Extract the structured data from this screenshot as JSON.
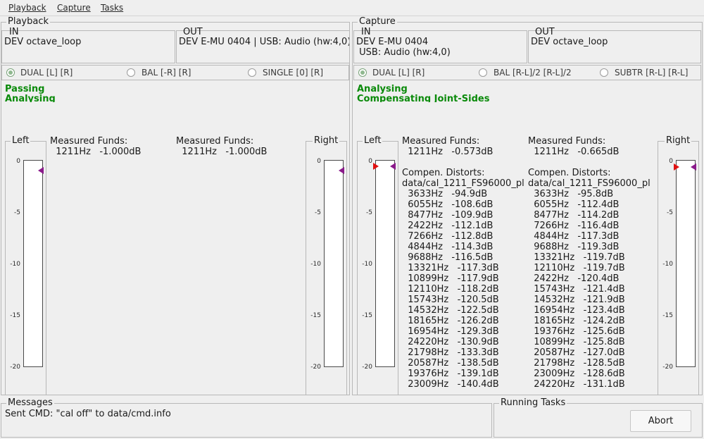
{
  "menu": [
    "Playback",
    "Capture",
    "Tasks"
  ],
  "playback": {
    "title": "Playback",
    "in_label": "IN",
    "in_value": "DEV octave_loop",
    "out_label": "OUT",
    "out_value": "DEV E-MU 0404 | USB: Audio (hw:4,0)",
    "radios": [
      {
        "label": "DUAL [L] [R]",
        "selected": true
      },
      {
        "label": "BAL [-R] [R]",
        "selected": false
      },
      {
        "label": "SINGLE [0] [R]",
        "selected": false
      }
    ],
    "status_lines": [
      "Passing",
      "Analysing"
    ],
    "left_meter_label": "Left",
    "right_meter_label": "Right",
    "left": {
      "funds_label": "Measured Funds:",
      "funds": "  1211Hz   -1.000dB"
    },
    "right": {
      "funds_label": "Measured Funds:",
      "funds": "  1211Hz   -1.000dB"
    },
    "meters": {
      "left_marker_db": -1.0,
      "right_marker_db": -1.0
    }
  },
  "capture": {
    "title": "Capture",
    "in_label": "IN",
    "in_value_line1": "DEV E-MU 0404",
    "in_value_line2": " USB: Audio (hw:4,0)",
    "out_label": "OUT",
    "out_value": "DEV octave_loop",
    "radios": [
      {
        "label": "DUAL [L] [R]",
        "selected": true
      },
      {
        "label": "BAL [R-L]/2 [R-L]/2",
        "selected": false
      },
      {
        "label": "SUBTR [R-L] [R-L]",
        "selected": false
      }
    ],
    "status_lines": [
      "Analysing",
      "Compensating Joint-Sides"
    ],
    "left_meter_label": "Left",
    "right_meter_label": "Right",
    "meters": {
      "left_marker_db": -0.573,
      "right_marker_db": -0.665
    },
    "left": {
      "funds_label": "Measured Funds:",
      "funds": "  1211Hz   -0.573dB",
      "distorts_label": "Compen. Distorts:",
      "distorts_file": "data/cal_1211_FS96000_pl",
      "distorts": [
        "  3633Hz   -94.9dB",
        "  6055Hz   -108.6dB",
        "  8477Hz   -109.9dB",
        "  2422Hz   -112.1dB",
        "  7266Hz   -112.8dB",
        "  4844Hz   -114.3dB",
        "  9688Hz   -116.5dB",
        "  13321Hz   -117.3dB",
        "  10899Hz   -117.9dB",
        "  12110Hz   -118.2dB",
        "  15743Hz   -120.5dB",
        "  14532Hz   -122.5dB",
        "  18165Hz   -126.2dB",
        "  16954Hz   -129.3dB",
        "  24220Hz   -130.9dB",
        "  21798Hz   -133.3dB",
        "  20587Hz   -138.5dB",
        "  19376Hz   -139.1dB",
        "  23009Hz   -140.4dB"
      ]
    },
    "right": {
      "funds_label": "Measured Funds:",
      "funds": "  1211Hz   -0.665dB",
      "distorts_label": "Compen. Distorts:",
      "distorts_file": "data/cal_1211_FS96000_pl",
      "distorts": [
        "  3633Hz   -95.8dB",
        "  6055Hz   -112.4dB",
        "  8477Hz   -114.2dB",
        "  7266Hz   -116.4dB",
        "  4844Hz   -117.3dB",
        "  9688Hz   -119.3dB",
        "  13321Hz   -119.7dB",
        "  12110Hz   -119.7dB",
        "  2422Hz   -120.4dB",
        "  15743Hz   -121.4dB",
        "  14532Hz   -121.9dB",
        "  16954Hz   -123.4dB",
        "  18165Hz   -124.2dB",
        "  19376Hz   -125.6dB",
        "  10899Hz   -125.8dB",
        "  20587Hz   -127.0dB",
        "  21798Hz   -128.5dB",
        "  23009Hz   -128.6dB",
        "  24220Hz   -131.1dB"
      ]
    }
  },
  "meter_ticks": [
    "0",
    "-5",
    "-10",
    "-15",
    "-20"
  ],
  "meter_range_db": [
    -20,
    0
  ],
  "colors": {
    "status": "#0a8a0a",
    "marker_input": "#e01010",
    "marker_output": "#8a1a8a"
  },
  "messages": {
    "title": "Messages",
    "text": "Sent CMD: \"cal off\" to data/cmd.info"
  },
  "tasks": {
    "title": "Running Tasks",
    "abort_label": "Abort"
  }
}
